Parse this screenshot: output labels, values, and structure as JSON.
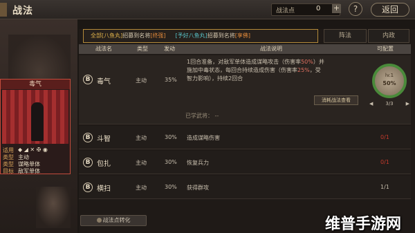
{
  "header": {
    "title": "战法",
    "points_label": "战法点",
    "points_value": "0",
    "plus_label": "+",
    "help_label": "?",
    "back_label": "返回"
  },
  "tabs": {
    "main_part1": "全部[八鱼丸]",
    "main_part2": "招募到名将",
    "main_part3": "[终强]",
    "main_part4": "[予好八鱼丸]",
    "main_part5": "招募到名将",
    "main_part6": "[享佛]",
    "zhenfa": "阵法",
    "neizheng": "内政"
  },
  "table": {
    "headers": [
      "战法名",
      "类型",
      "发动",
      "战法说明",
      "可配置"
    ]
  },
  "main_skill": {
    "grade": "B",
    "name": "毒气",
    "type": "主动",
    "rate": "35%",
    "desc_line1": "1回合准备，对敌军单体造成谋略攻击（伤害率",
    "desc_hl1": "50%",
    "desc_line1b": "）并",
    "desc_line2": "施加中毒状态，每回合持续造成伤害（伤害率",
    "desc_hl2": "25%",
    "desc_line2b": "，受",
    "desc_line3": "智力影响），持续2回合",
    "detail_label": "消耗战法查看",
    "learned_label": "已学武将：  --",
    "ring_level": "lv.1",
    "ring_pct": "50%",
    "ring_count": "3/3"
  },
  "skills": [
    {
      "grade": "B",
      "name": "斗智",
      "type": "主动",
      "rate": "30%",
      "desc": "造成谋略伤害",
      "slots": "0/1",
      "slots_color": "#c53a2c"
    },
    {
      "grade": "B",
      "name": "包扎",
      "type": "主动",
      "rate": "30%",
      "desc": "恢复兵力",
      "slots": "0/1",
      "slots_color": "#c53a2c"
    },
    {
      "grade": "B",
      "name": "横扫",
      "type": "主动",
      "rate": "30%",
      "desc": "获得群攻",
      "slots": "1/1",
      "slots_color": "#c9bfae"
    }
  ],
  "card": {
    "title": "毒气",
    "rows": [
      {
        "k": "适用",
        "v": ""
      },
      {
        "k": "类型",
        "v": "主动"
      },
      {
        "k": "类型",
        "v": "谋略单体"
      },
      {
        "k": "目标",
        "v": "敌军单体"
      }
    ]
  },
  "footer": {
    "convert_label": "战法点转化"
  },
  "watermark": "维普手游网"
}
